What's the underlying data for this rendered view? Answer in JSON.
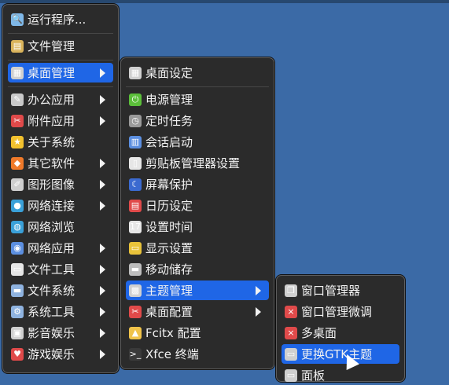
{
  "menu1": {
    "items": [
      {
        "label": "运行程序...",
        "icon": "search-icon",
        "color": "#7fb8e8",
        "glyph": "🔍"
      },
      {
        "label": "文件管理",
        "icon": "file-manager-icon",
        "color": "#d9b35b",
        "glyph": "▤"
      },
      {
        "label": "桌面管理",
        "icon": "desktop-icon",
        "color": "#d0d0d0",
        "glyph": "▦"
      },
      {
        "label": "办公应用",
        "icon": "office-icon",
        "color": "#c9c9c9",
        "glyph": "✎"
      },
      {
        "label": "附件应用",
        "icon": "accessories-icon",
        "color": "#e04a4a",
        "glyph": "✂"
      },
      {
        "label": "关于系统",
        "icon": "star-icon",
        "color": "#f2c12e",
        "glyph": "★"
      },
      {
        "label": "其它软件",
        "icon": "other-icon",
        "color": "#f07a2a",
        "glyph": "◆"
      },
      {
        "label": "图形图像",
        "icon": "graphics-icon",
        "color": "#cfcfcf",
        "glyph": "✐"
      },
      {
        "label": "网络连接",
        "icon": "network-icon",
        "color": "#3aa0d8",
        "glyph": "●"
      },
      {
        "label": "网络浏览",
        "icon": "browser-icon",
        "color": "#3aa0d8",
        "glyph": "◍"
      },
      {
        "label": "网络应用",
        "icon": "globe-icon",
        "color": "#5c8fe0",
        "glyph": "◉"
      },
      {
        "label": "文件工具",
        "icon": "file-tools-icon",
        "color": "#e6e6e6",
        "glyph": "▭"
      },
      {
        "label": "文件系统",
        "icon": "folder-icon",
        "color": "#8fb3e0",
        "glyph": "▬"
      },
      {
        "label": "系统工具",
        "icon": "gear-icon",
        "color": "#8fb3e0",
        "glyph": "⚙"
      },
      {
        "label": "影音娱乐",
        "icon": "media-icon",
        "color": "#cfcfcf",
        "glyph": "▣"
      },
      {
        "label": "游戏娱乐",
        "icon": "games-icon",
        "color": "#e04a4a",
        "glyph": "♥"
      }
    ]
  },
  "menu2": {
    "items": [
      {
        "label": "桌面设定",
        "icon": "desktop-settings-icon",
        "color": "#d0d0d0",
        "glyph": "▦"
      },
      {
        "label": "电源管理",
        "icon": "power-icon",
        "color": "#5bbf3a",
        "glyph": "⏻"
      },
      {
        "label": "定时任务",
        "icon": "clock-icon",
        "color": "#9a9a9a",
        "glyph": "◷"
      },
      {
        "label": "会话启动",
        "icon": "session-icon",
        "color": "#5c8fe0",
        "glyph": "▥"
      },
      {
        "label": "剪贴板管理器设置",
        "icon": "clipboard-icon",
        "color": "#e6e6e6",
        "glyph": "▯"
      },
      {
        "label": "屏幕保护",
        "icon": "screensaver-icon",
        "color": "#3b6ad0",
        "glyph": "☾"
      },
      {
        "label": "日历设定",
        "icon": "calendar-icon",
        "color": "#e04a4a",
        "glyph": "▤"
      },
      {
        "label": "设置时间",
        "icon": "time-icon",
        "color": "#e6e6e6",
        "glyph": "17"
      },
      {
        "label": "显示设置",
        "icon": "display-icon",
        "color": "#e8c23a",
        "glyph": "▭"
      },
      {
        "label": "移动储存",
        "icon": "storage-icon",
        "color": "#bdbdbd",
        "glyph": "▬"
      },
      {
        "label": "主题管理",
        "icon": "theme-icon",
        "color": "#d0d0d0",
        "glyph": "▩"
      },
      {
        "label": "桌面配置",
        "icon": "desktop-config-icon",
        "color": "#e04a4a",
        "glyph": "✂"
      },
      {
        "label": "Fcitx 配置",
        "icon": "penguin-icon",
        "color": "#f0c34a",
        "glyph": "▲"
      },
      {
        "label": "Xfce 终端",
        "icon": "terminal-icon",
        "color": "#3a3a3a",
        "glyph": ">_"
      }
    ]
  },
  "menu3": {
    "items": [
      {
        "label": "窗口管理器",
        "icon": "windows-icon",
        "color": "#cfcfcf",
        "glyph": "❐"
      },
      {
        "label": "窗口管理微调",
        "icon": "window-tweaks-icon",
        "color": "#e04a4a",
        "glyph": "×"
      },
      {
        "label": "多桌面",
        "icon": "workspaces-icon",
        "color": "#e04a4a",
        "glyph": "×"
      },
      {
        "label": "更换GTK主题",
        "icon": "gtk-theme-icon",
        "color": "#cfcfcf",
        "glyph": "▭"
      },
      {
        "label": "面板",
        "icon": "panel-icon",
        "color": "#cfcfcf",
        "glyph": "▭"
      }
    ]
  }
}
